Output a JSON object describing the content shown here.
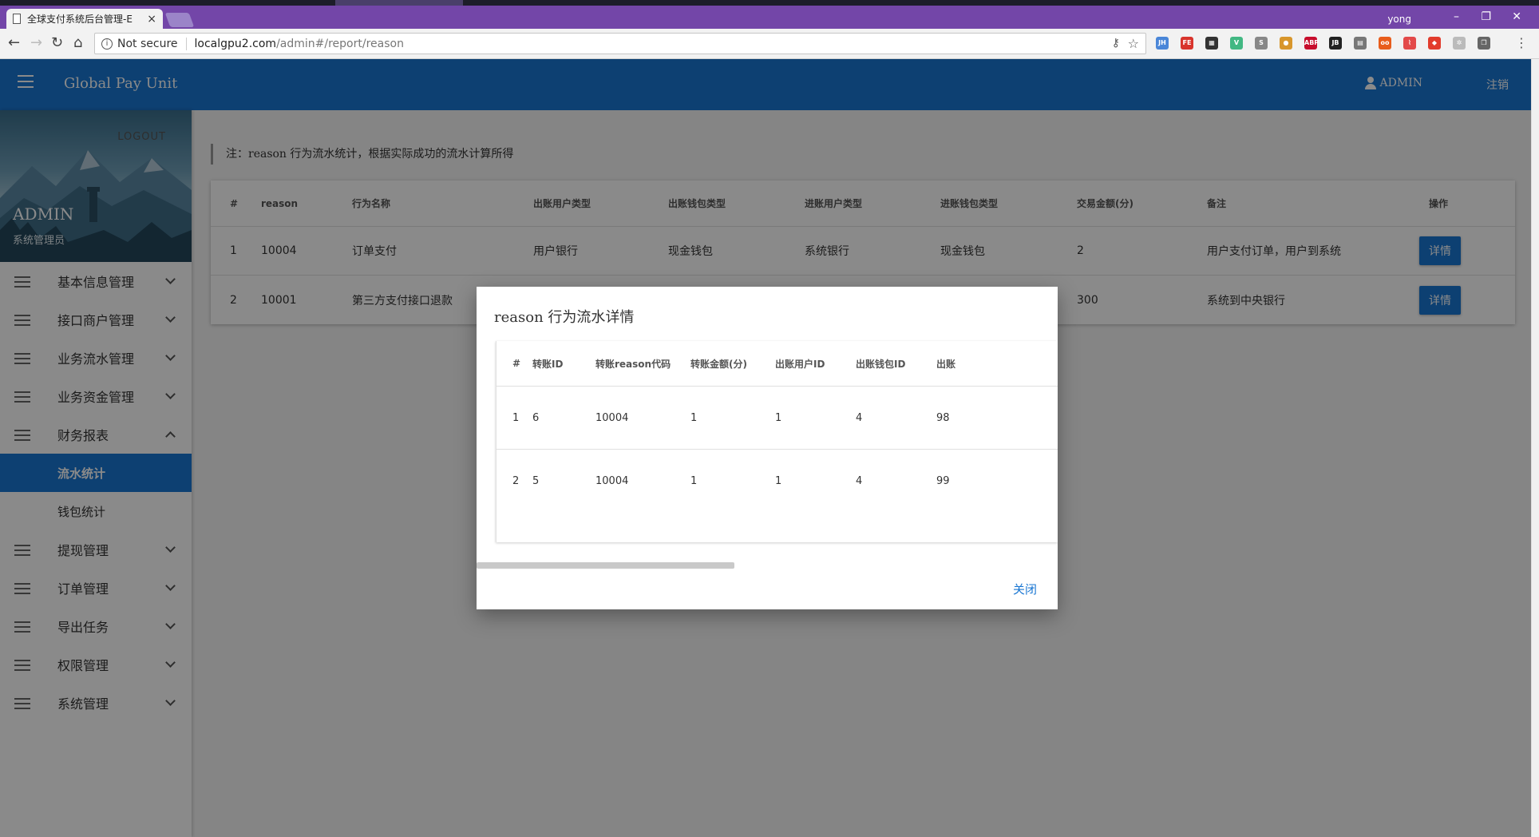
{
  "browser": {
    "tab_title": "全球支付系统后台管理-E",
    "tab_close": "×",
    "profile_name": "yong",
    "security_label": "Not secure",
    "url_host": "localgpu2.com",
    "url_path": "/admin#/report/reason",
    "extensions": [
      {
        "name": "jh-extension-icon",
        "label": "JH",
        "color": "#4a86d8"
      },
      {
        "name": "fe-extension-icon",
        "label": "FE",
        "color": "#d8342c"
      },
      {
        "name": "grid-extension-icon",
        "label": "▦",
        "color": "#333333"
      },
      {
        "name": "vue-devtools-icon",
        "label": "V",
        "color": "#42b883"
      },
      {
        "name": "s-extension-icon",
        "label": "S",
        "color": "#888888"
      },
      {
        "name": "cookie-extension-icon",
        "label": "●",
        "color": "#d8962c"
      },
      {
        "name": "adblock-plus-icon",
        "label": "ABP",
        "color": "#c70d2c"
      },
      {
        "name": "jetbrains-extension-icon",
        "label": "JB",
        "color": "#222222"
      },
      {
        "name": "page-extension-icon",
        "label": "▤",
        "color": "#777777"
      },
      {
        "name": "co-extension-icon",
        "label": "oo",
        "color": "#e85d1c"
      },
      {
        "name": "ribbon-extension-icon",
        "label": "⌇",
        "color": "#e34a4a"
      },
      {
        "name": "fire-extension-icon",
        "label": "◆",
        "color": "#e23b2c"
      },
      {
        "name": "gear-extension-icon",
        "label": "✲",
        "color": "#bbbbbb"
      },
      {
        "name": "copy-extension-icon",
        "label": "❐",
        "color": "#666666"
      }
    ]
  },
  "header": {
    "brand": "Global Pay Unit",
    "user_label": "ADMIN",
    "logout_label": "注销"
  },
  "sidebar": {
    "logout": "LOGOUT",
    "name": "ADMIN",
    "role": "系统管理员",
    "menu": [
      {
        "name": "menu-basic-info",
        "label": "基本信息管理",
        "expanded": false
      },
      {
        "name": "menu-merchant",
        "label": "接口商户管理",
        "expanded": false
      },
      {
        "name": "menu-business-flow",
        "label": "业务流水管理",
        "expanded": false
      },
      {
        "name": "menu-business-funds",
        "label": "业务资金管理",
        "expanded": false
      },
      {
        "name": "menu-finance-report",
        "label": "财务报表",
        "expanded": true,
        "children": [
          {
            "name": "submenu-flow-stats",
            "label": "流水统计",
            "active": true
          },
          {
            "name": "submenu-wallet-stats",
            "label": "钱包统计",
            "active": false
          }
        ]
      },
      {
        "name": "menu-withdraw",
        "label": "提现管理",
        "expanded": false
      },
      {
        "name": "menu-order",
        "label": "订单管理",
        "expanded": false
      },
      {
        "name": "menu-export",
        "label": "导出任务",
        "expanded": false
      },
      {
        "name": "menu-permission",
        "label": "权限管理",
        "expanded": false
      },
      {
        "name": "menu-system",
        "label": "系统管理",
        "expanded": false
      }
    ]
  },
  "page": {
    "note": "注：reason 行为流水统计，根据实际成功的流水计算所得",
    "table": {
      "headers": [
        "#",
        "reason",
        "行为名称",
        "出账用户类型",
        "出账钱包类型",
        "进账用户类型",
        "进账钱包类型",
        "交易金额(分)",
        "备注",
        "操作"
      ],
      "rows": [
        [
          "1",
          "10004",
          "订单支付",
          "用户银行",
          "现金钱包",
          "系统银行",
          "现金钱包",
          "2",
          "用户支付订单，用户到系统",
          "详情"
        ],
        [
          "2",
          "10001",
          "第三方支付接口退款",
          "",
          "",
          "",
          "",
          "300",
          "系统到中央银行",
          "详情"
        ]
      ]
    }
  },
  "dialog": {
    "title": "reason 行为流水详情",
    "headers": [
      "#",
      "转账ID",
      "转账reason代码",
      "转账金额(分)",
      "出账用户ID",
      "出账钱包ID",
      "出账"
    ],
    "rows": [
      [
        "1",
        "6",
        "10004",
        "1",
        "1",
        "4",
        "98"
      ],
      [
        "2",
        "5",
        "10004",
        "1",
        "1",
        "4",
        "99"
      ]
    ],
    "close_label": "关闭"
  }
}
